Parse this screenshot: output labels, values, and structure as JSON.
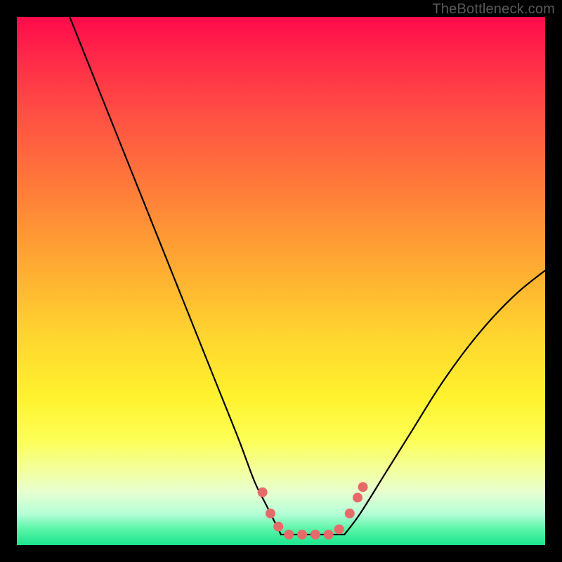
{
  "watermark": {
    "text": "TheBottleneck.com"
  },
  "chart_data": {
    "type": "line",
    "title": "",
    "xlabel": "",
    "ylabel": "",
    "xlim": [
      0,
      100
    ],
    "ylim": [
      0,
      100
    ],
    "grid": false,
    "legend": false,
    "background_gradient": {
      "direction": "vertical",
      "stops": [
        {
          "pos": 0,
          "color": "#ff0a4a"
        },
        {
          "pos": 18,
          "color": "#ff4e44"
        },
        {
          "pos": 46,
          "color": "#ffa733"
        },
        {
          "pos": 72,
          "color": "#fff22e"
        },
        {
          "pos": 90,
          "color": "#e7ffd0"
        },
        {
          "pos": 100,
          "color": "#19e48c"
        }
      ]
    },
    "series": [
      {
        "name": "left-branch",
        "x": [
          10,
          14,
          18,
          22,
          26,
          30,
          34,
          38,
          42,
          45,
          47,
          49,
          50
        ],
        "y": [
          100,
          90,
          80,
          70,
          60,
          50,
          40,
          30,
          20,
          12,
          8,
          4,
          2
        ]
      },
      {
        "name": "valley-floor",
        "x": [
          50,
          53,
          56,
          59,
          62
        ],
        "y": [
          2,
          2,
          2,
          2,
          2
        ]
      },
      {
        "name": "right-branch",
        "x": [
          62,
          65,
          70,
          75,
          80,
          85,
          90,
          95,
          100
        ],
        "y": [
          2,
          6,
          14,
          22,
          30,
          37,
          43,
          48,
          52
        ]
      }
    ],
    "markers": {
      "name": "highlight-dots",
      "color": "#e76a6a",
      "size": 7,
      "points": [
        {
          "x": 46.5,
          "y": 10
        },
        {
          "x": 48.0,
          "y": 6
        },
        {
          "x": 49.5,
          "y": 3.5
        },
        {
          "x": 51.5,
          "y": 2
        },
        {
          "x": 54.0,
          "y": 2
        },
        {
          "x": 56.5,
          "y": 2
        },
        {
          "x": 59.0,
          "y": 2
        },
        {
          "x": 61.0,
          "y": 3
        },
        {
          "x": 63.0,
          "y": 6
        },
        {
          "x": 64.5,
          "y": 9
        },
        {
          "x": 65.5,
          "y": 11
        }
      ]
    }
  }
}
